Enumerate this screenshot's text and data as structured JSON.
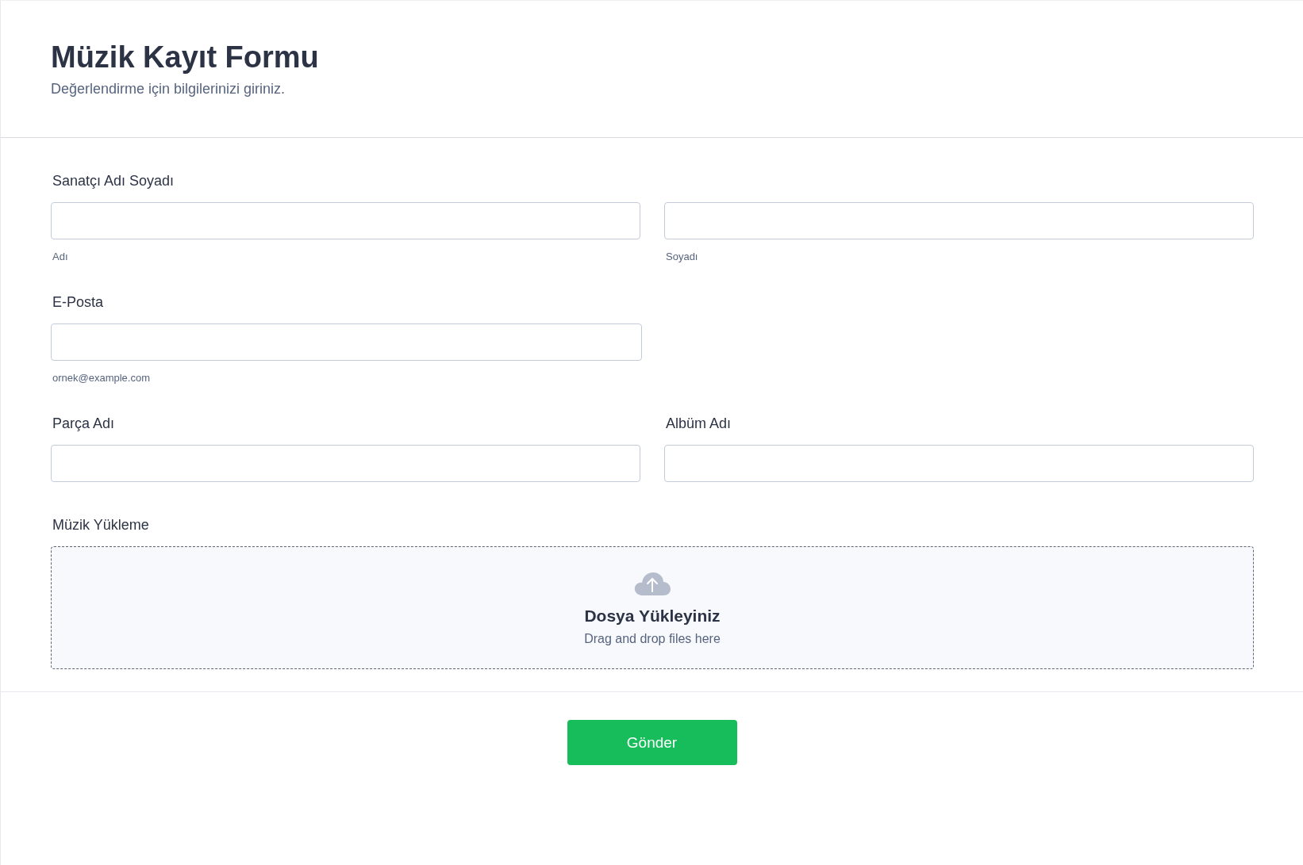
{
  "header": {
    "title": "Müzik Kayıt Formu",
    "subtitle": "Değerlendirme için bilgilerinizi giriniz."
  },
  "fields": [
    {
      "kind": "pair",
      "label": "Sanatçı Adı Soyadı",
      "inputs": [
        {
          "sublabel": "Adı"
        },
        {
          "sublabel": "Soyadı"
        }
      ]
    },
    {
      "kind": "single",
      "label": "E-Posta",
      "inputs": [
        {
          "sublabel": "ornek@example.com"
        }
      ]
    },
    {
      "kind": "columns",
      "columns": [
        {
          "label": "Parça Adı"
        },
        {
          "label": "Albüm Adı"
        }
      ]
    },
    {
      "kind": "upload",
      "label": "Müzik Yükleme",
      "title": "Dosya Yükleyiniz",
      "hint": "Drag and drop files here"
    }
  ],
  "submit": {
    "label": "Gönder"
  }
}
